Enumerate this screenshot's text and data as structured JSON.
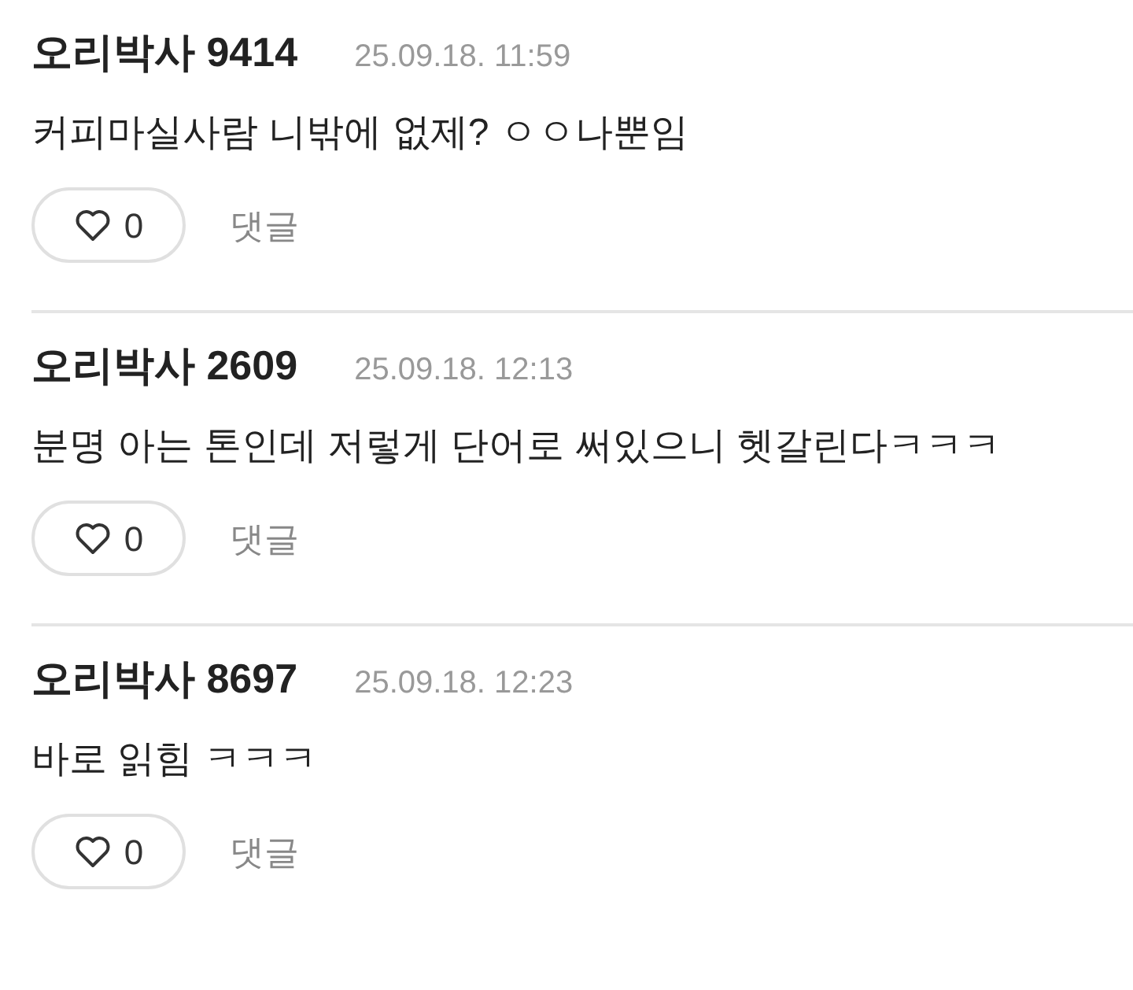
{
  "comments": [
    {
      "author": "오리박사 9414",
      "date": "25.09.18. 11:59",
      "text": "커피마실사람 니밖에 없제? ㅇㅇ나뿐임",
      "likes": "0",
      "reply_label": "댓글"
    },
    {
      "author": "오리박사 2609",
      "date": "25.09.18. 12:13",
      "text": "분명 아는 톤인데 저렇게 단어로 써있으니 헷갈린다ㅋㅋㅋ",
      "likes": "0",
      "reply_label": "댓글"
    },
    {
      "author": "오리박사 8697",
      "date": "25.09.18. 12:23",
      "text": "바로 읽힘 ㅋㅋㅋ",
      "likes": "0",
      "reply_label": "댓글"
    }
  ]
}
